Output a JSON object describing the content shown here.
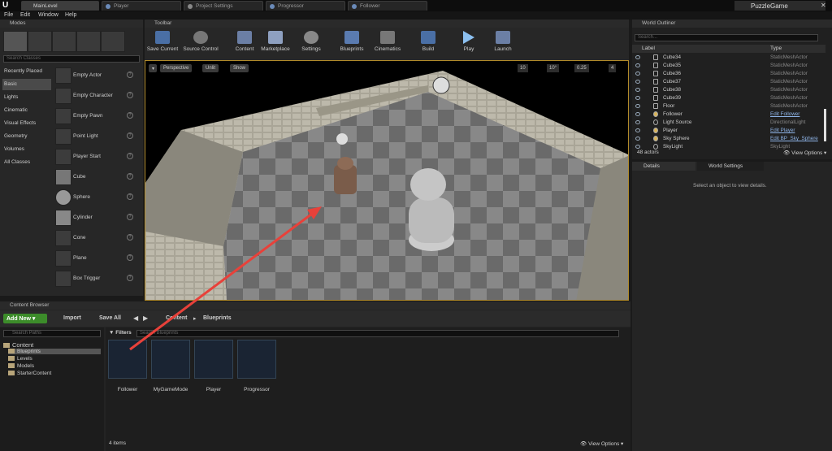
{
  "tabs": [
    {
      "label": "MainLevel",
      "active": true
    },
    {
      "label": "Player"
    },
    {
      "label": "Project Settings"
    },
    {
      "label": "Progressor"
    },
    {
      "label": "Follower"
    }
  ],
  "project_name": "PuzzleGame",
  "menu": [
    "File",
    "Edit",
    "Window",
    "Help"
  ],
  "modes": {
    "title": "Modes",
    "search_placeholder": "Search Classes",
    "categories": [
      "Recently Placed",
      "Basic",
      "Lights",
      "Cinematic",
      "Visual Effects",
      "Geometry",
      "Volumes",
      "All Classes"
    ],
    "selected_category": "Basic",
    "items": [
      "Empty Actor",
      "Empty Character",
      "Empty Pawn",
      "Point Light",
      "Player Start",
      "Cube",
      "Sphere",
      "Cylinder",
      "Cone",
      "Plane",
      "Box Trigger"
    ]
  },
  "toolbar": {
    "title": "Toolbar",
    "buttons": [
      "Save Current",
      "Source Control",
      "Content",
      "Marketplace",
      "Settings",
      "Blueprints",
      "Cinematics",
      "Build",
      "Play",
      "Launch"
    ]
  },
  "viewport": {
    "perspective": "Perspective",
    "lit": "Unlit",
    "show": "Show",
    "grid": "10",
    "angle": "10°",
    "scale": "0.25",
    "cam": "4"
  },
  "outliner": {
    "title": "World Outliner",
    "search_placeholder": "Search...",
    "col_label": "Label",
    "col_type": "Type",
    "rows": [
      {
        "label": "Cube34",
        "type": "StaticMeshActor"
      },
      {
        "label": "Cube35",
        "type": "StaticMeshActor"
      },
      {
        "label": "Cube36",
        "type": "StaticMeshActor"
      },
      {
        "label": "Cube37",
        "type": "StaticMeshActor"
      },
      {
        "label": "Cube38",
        "type": "StaticMeshActor"
      },
      {
        "label": "Cube39",
        "type": "StaticMeshActor"
      },
      {
        "label": "Floor",
        "type": "StaticMeshActor"
      },
      {
        "label": "Follower",
        "type": "Edit Follower",
        "link": true
      },
      {
        "label": "Light Source",
        "type": "DirectionalLight"
      },
      {
        "label": "Player",
        "type": "Edit Player",
        "link": true
      },
      {
        "label": "Sky Sphere",
        "type": "Edit BP_Sky_Sphere",
        "link": true
      },
      {
        "label": "SkyLight",
        "type": "SkyLight"
      }
    ],
    "count": "48 actors",
    "view_options": "View Options"
  },
  "details": {
    "tab1": "Details",
    "tab2": "World Settings",
    "empty": "Select an object to view details."
  },
  "content_browser": {
    "title": "Content Browser",
    "add_new": "Add New",
    "import": "Import",
    "save_all": "Save All",
    "path": [
      "Content",
      "Blueprints"
    ],
    "search_paths": "Search Paths",
    "filters": "Filters",
    "search_blueprints": "Search Blueprints",
    "tree": [
      "Content",
      "Blueprints",
      "Levels",
      "Models",
      "StarterContent"
    ],
    "assets": [
      "Follower",
      "MyGameMode",
      "Player",
      "Progressor"
    ],
    "items_count": "4 items",
    "view_options": "View Options"
  },
  "colors": {
    "accent": "#b08a2a",
    "add_new": "#3c8c2a",
    "arrow": "#e8413a",
    "link": "#8fb5e8"
  }
}
